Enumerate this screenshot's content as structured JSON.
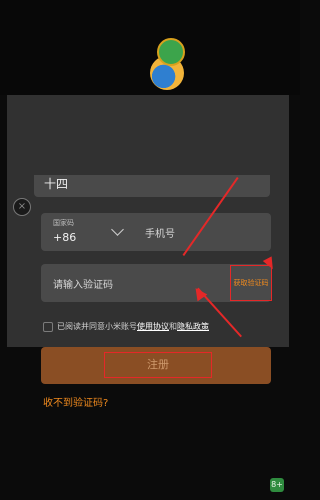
{
  "header": {
    "logo_icon": "globe-rocket-icon",
    "close_icon": "close-icon"
  },
  "form": {
    "top_field_text": "十四",
    "country_label": "国家码",
    "country_code": "+86",
    "phone_placeholder": "手机号",
    "code_placeholder": "请输入验证码",
    "get_code_label": "获取验证码",
    "agree_prefix": "已阅读并同意小米账号",
    "terms_link": "使用协议",
    "and_text": "和",
    "privacy_link": "隐私政策",
    "register_label": "注册",
    "no_code_link": "收不到验证码?"
  },
  "annotation": {
    "arrow_color": "#e52828"
  },
  "badge": {
    "text": "8+"
  }
}
